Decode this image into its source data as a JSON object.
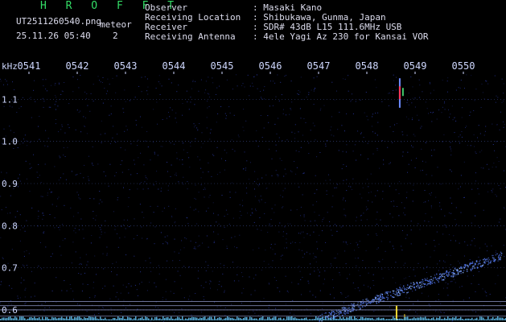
{
  "header": {
    "title": "H R O F F T",
    "filename": "UT2511260540.png",
    "tag": "meteor",
    "timestamp": "25.11.26 05:40",
    "channel": "2",
    "fields": [
      {
        "label": "Observer",
        "value": ": Masaki Kano"
      },
      {
        "label": "Receiving Location",
        "value": ": Shibukawa, Gunma, Japan"
      },
      {
        "label": "Receiver",
        "value": ": SDR# 43dB L15 111.6MHz USB"
      },
      {
        "label": "Receiving Antenna",
        "value": ": 4ele Yagi Az 230 for Kansai VOR"
      }
    ]
  },
  "spectrogram": {
    "y_unit": "kHz",
    "y_ticks": [
      "1.1",
      "1.0",
      "0.9",
      "0.8",
      "0.7",
      "0.6"
    ],
    "y_range": [
      0.575,
      1.16
    ],
    "x_ticks": [
      "0541",
      "0542",
      "0543",
      "0544",
      "0545",
      "0546",
      "0547",
      "0548",
      "0549",
      "0550"
    ],
    "x_range": [
      0,
      10
    ],
    "colors": {
      "background": "#000000",
      "dots": "#2a3aa8",
      "grid": "#3b4a8a",
      "axis_text": "#cfd8ff",
      "header_title": "#33dd66",
      "meteor": "#ffdd33",
      "baseline": "#66ccff"
    },
    "meteor_trail": {
      "x_minutes": 7.95,
      "freq_top": 1.15,
      "freq_bottom": 1.08
    },
    "reference_lines": [
      0.62,
      0.61,
      0.6,
      0.585
    ],
    "sweep": {
      "start": [
        6.3,
        0.578
      ],
      "end": [
        10.0,
        0.73
      ]
    }
  }
}
